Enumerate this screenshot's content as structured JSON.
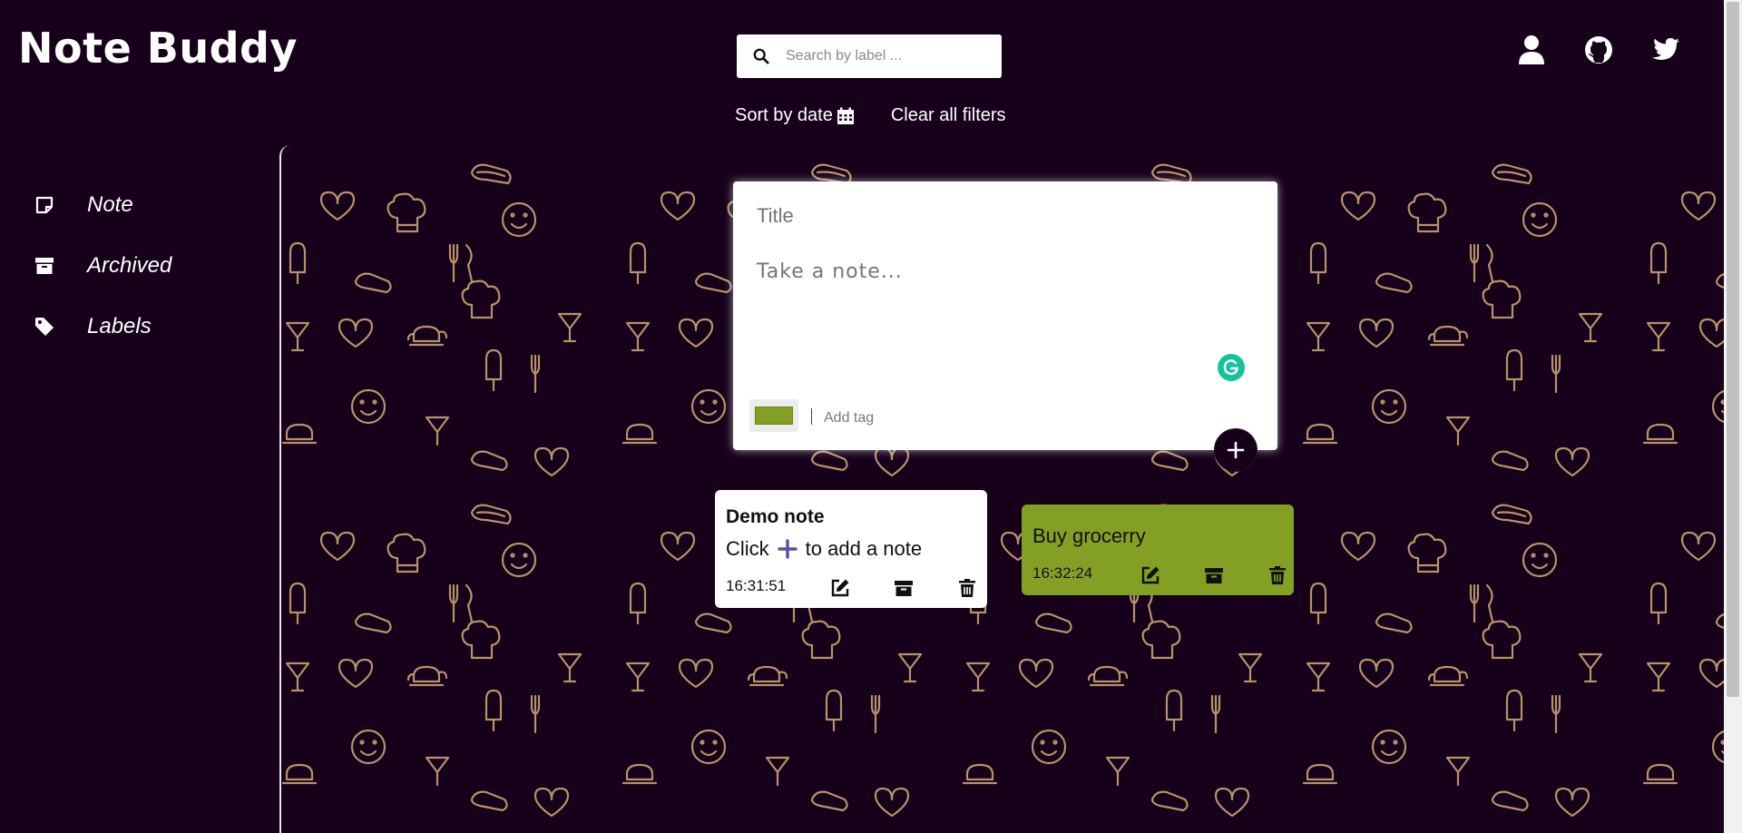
{
  "app": {
    "title": "Note Buddy"
  },
  "search": {
    "placeholder": "Search by label ..."
  },
  "filters": {
    "sort_label": "Sort by date",
    "clear_label": "Clear all filters"
  },
  "header_icons": [
    "user-icon",
    "github-icon",
    "twitter-icon"
  ],
  "sidebar": {
    "items": [
      {
        "label": "Note",
        "icon": "note-icon"
      },
      {
        "label": "Archived",
        "icon": "archive-icon"
      },
      {
        "label": "Labels",
        "icon": "tag-icon"
      }
    ]
  },
  "composer": {
    "title_placeholder": "Title",
    "body_placeholder": "Take a note...",
    "tag_placeholder": "Add tag",
    "selected_color": "#83a024"
  },
  "notes": [
    {
      "title": "Demo note",
      "body_prefix": "Click",
      "body_suffix": "to add a note",
      "time": "16:31:51",
      "color": "#ffffff"
    },
    {
      "title": "",
      "body": "Buy grocerry",
      "time": "16:32:24",
      "color": "#83a024"
    }
  ],
  "colors": {
    "background": "#16001a",
    "accent": "#83a024",
    "pattern": "#b8926a",
    "add_plus": "#5b4fa0"
  }
}
